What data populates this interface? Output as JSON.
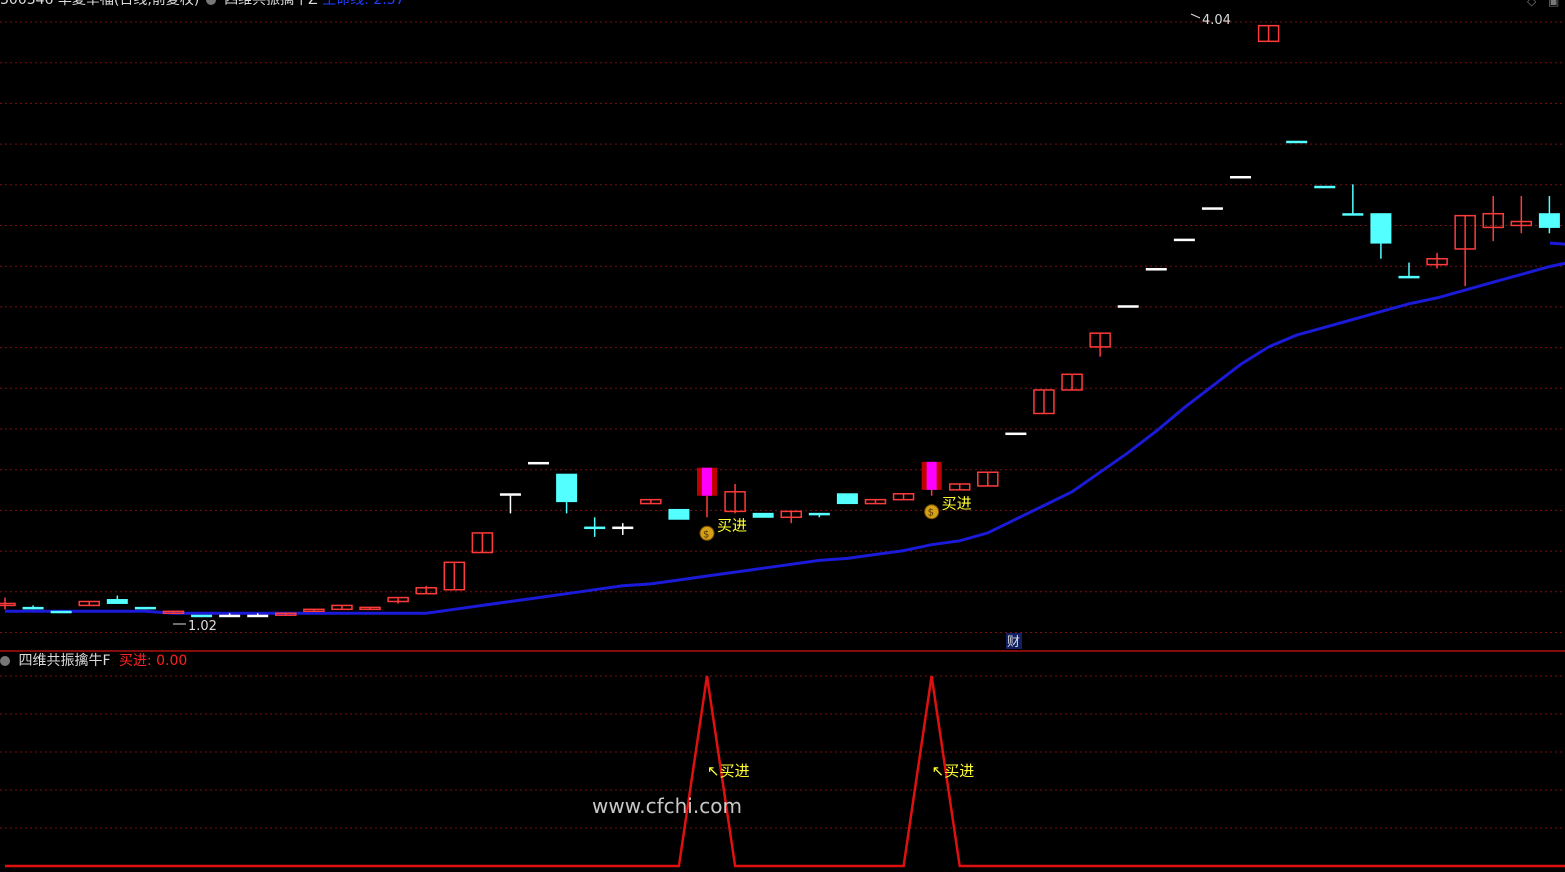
{
  "colors": {
    "background": "#000000",
    "grid": "#7a1010",
    "up_candle": "#ff3a3a",
    "down_candle": "#54ffff",
    "doji": "#ffffff",
    "ma_line": "#1a1ad8",
    "signal_candle": "#ff00ff",
    "signal_text": "#ffff33",
    "indicator_line": "#e01010",
    "header_text": "#dcdcdc",
    "header_value": "#ff2020",
    "header_value_blue": "#2040ff"
  },
  "main_panel": {
    "header": {
      "code": "300346",
      "title": "华夏幸福(日线,前复权)",
      "indicator": "四维共振擒牛Z",
      "value_label": "生命线: 2.57"
    },
    "max_label": "4.04",
    "min_label": "1.02",
    "fin_badge": "财",
    "signal_label": "买进",
    "coin_icon": "money-bag-icon"
  },
  "sub_panel": {
    "header": {
      "title": "四维共振擒牛F",
      "value_label": "买进: 0.00"
    },
    "signal_label": "买进"
  },
  "watermark": "www.cfchi.com",
  "chart_data": [
    {
      "type": "candlestick",
      "title": "华夏幸福(日线,前复权)",
      "ylim": [
        0.98,
        4.12
      ],
      "max_price": 4.04,
      "min_price": 1.02,
      "series": [
        {
          "name": "K",
          "ohlc": [
            [
              1.08,
              1.12,
              1.06,
              1.09
            ],
            [
              1.07,
              1.08,
              1.06,
              1.07
            ],
            [
              1.05,
              1.05,
              1.05,
              1.05
            ],
            [
              1.08,
              1.1,
              1.08,
              1.1
            ],
            [
              1.11,
              1.13,
              1.09,
              1.09
            ],
            [
              1.07,
              1.07,
              1.06,
              1.07
            ],
            [
              1.04,
              1.05,
              1.04,
              1.05
            ],
            [
              1.03,
              1.03,
              1.02,
              1.03
            ],
            [
              1.03,
              1.04,
              1.03,
              1.03
            ],
            [
              1.03,
              1.04,
              1.03,
              1.03
            ],
            [
              1.03,
              1.04,
              1.03,
              1.04
            ],
            [
              1.05,
              1.06,
              1.05,
              1.06
            ],
            [
              1.06,
              1.08,
              1.06,
              1.08
            ],
            [
              1.06,
              1.07,
              1.06,
              1.07
            ],
            [
              1.1,
              1.12,
              1.09,
              1.12
            ],
            [
              1.14,
              1.18,
              1.14,
              1.17
            ],
            [
              1.16,
              1.3,
              1.16,
              1.3
            ],
            [
              1.35,
              1.45,
              1.35,
              1.45
            ],
            [
              1.65,
              1.65,
              1.55,
              1.65
            ],
            [
              1.81,
              1.81,
              1.81,
              1.81
            ],
            [
              1.75,
              1.75,
              1.55,
              1.61
            ],
            [
              1.48,
              1.53,
              1.43,
              1.48
            ],
            [
              1.48,
              1.5,
              1.44,
              1.48
            ],
            [
              1.6,
              1.62,
              1.6,
              1.62
            ],
            [
              1.57,
              1.57,
              1.52,
              1.52
            ],
            [
              1.53,
              1.64,
              1.53,
              1.64
            ],
            [
              1.56,
              1.7,
              1.55,
              1.66
            ],
            [
              1.55,
              1.55,
              1.53,
              1.53
            ],
            [
              1.53,
              1.56,
              1.5,
              1.56
            ],
            [
              1.55,
              1.55,
              1.53,
              1.55
            ],
            [
              1.65,
              1.65,
              1.6,
              1.6
            ],
            [
              1.6,
              1.62,
              1.6,
              1.62
            ],
            [
              1.62,
              1.65,
              1.62,
              1.65
            ],
            [
              1.64,
              1.7,
              1.64,
              1.67
            ],
            [
              1.67,
              1.7,
              1.67,
              1.7
            ],
            [
              1.69,
              1.76,
              1.69,
              1.76
            ],
            [
              1.96,
              1.96,
              1.96,
              1.96
            ],
            [
              2.06,
              2.18,
              2.06,
              2.18
            ],
            [
              2.18,
              2.18,
              2.26,
              2.26
            ],
            [
              2.4,
              2.47,
              2.35,
              2.47
            ],
            [
              2.61,
              2.61,
              2.61,
              2.61
            ],
            [
              2.8,
              2.8,
              2.8,
              2.8
            ],
            [
              2.95,
              2.95,
              2.95,
              2.95
            ],
            [
              3.11,
              3.11,
              3.11,
              3.11
            ],
            [
              3.27,
              3.27,
              3.27,
              3.27
            ],
            [
              3.96,
              4.04,
              3.96,
              4.04
            ],
            [
              3.45,
              3.45,
              3.45,
              3.45
            ],
            [
              3.22,
              3.22,
              3.22,
              3.22
            ],
            [
              3.08,
              3.23,
              3.08,
              3.08
            ],
            [
              3.08,
              3.08,
              2.85,
              2.93
            ],
            [
              2.76,
              2.83,
              2.76,
              2.76
            ],
            [
              2.82,
              2.88,
              2.8,
              2.85
            ],
            [
              2.9,
              3.07,
              2.71,
              3.07
            ],
            [
              3.01,
              3.17,
              2.94,
              3.08
            ],
            [
              3.02,
              3.17,
              2.98,
              3.04
            ],
            [
              3.08,
              3.17,
              2.98,
              3.01
            ],
            [
              3.08,
              3.09,
              2.95,
              2.95
            ],
            [
              2.87,
              2.94,
              2.87,
              2.87
            ],
            [
              2.82,
              3.05,
              2.8,
              3.05
            ]
          ]
        },
        {
          "name": "生命线",
          "values": [
            1.05,
            1.05,
            1.05,
            1.05,
            1.05,
            1.05,
            1.04,
            1.04,
            1.04,
            1.04,
            1.04,
            1.04,
            1.04,
            1.04,
            1.04,
            1.04,
            1.06,
            1.08,
            1.1,
            1.12,
            1.14,
            1.16,
            1.18,
            1.19,
            1.21,
            1.23,
            1.25,
            1.27,
            1.29,
            1.31,
            1.32,
            1.34,
            1.36,
            1.39,
            1.41,
            1.45,
            1.52,
            1.59,
            1.66,
            1.76,
            1.86,
            1.97,
            2.09,
            2.2,
            2.31,
            2.4,
            2.46,
            2.5,
            2.54,
            2.58,
            2.62,
            2.65,
            2.69,
            2.73,
            2.77,
            2.81,
            2.84,
            2.87,
            2.9
          ]
        }
      ],
      "signal_indices": [
        25,
        33
      ]
    },
    {
      "type": "line",
      "title": "四维共振擒牛F",
      "ylim": [
        0,
        1
      ],
      "series": [
        {
          "name": "买进",
          "values": [
            0,
            0,
            0,
            0,
            0,
            0,
            0,
            0,
            0,
            0,
            0,
            0,
            0,
            0,
            0,
            0,
            0,
            0,
            0,
            0,
            0,
            0,
            0,
            0,
            0,
            1,
            0,
            0,
            0,
            0,
            0,
            0,
            0,
            1,
            0,
            0,
            0,
            0,
            0,
            0,
            0,
            0,
            0,
            0,
            0,
            0,
            0,
            0,
            0,
            0,
            0,
            0,
            0,
            0,
            0,
            0,
            0,
            0,
            0
          ]
        }
      ]
    }
  ]
}
